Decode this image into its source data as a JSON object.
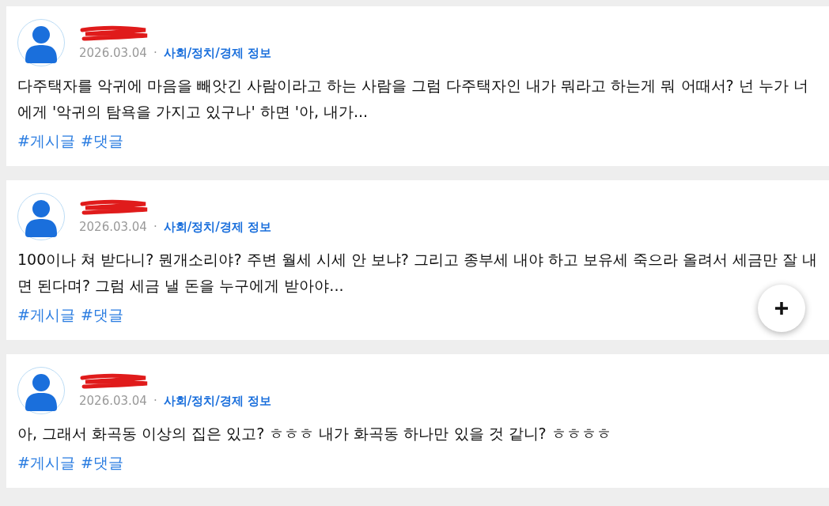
{
  "posts": [
    {
      "date": "2026.03.04",
      "separator": "·",
      "category": "사회/정치/경제 정보",
      "body": "다주택자를 악귀에 마음을 빼앗긴 사람이라고 하는 사람을 그럼 다주택자인 내가 뭐라고 하는게 뭐 어때서? 넌 누가 너에게 '악귀의 탐욕을 가지고 있구나' 하면 '아, 내가...",
      "tags": [
        "#게시글",
        "#댓글"
      ]
    },
    {
      "date": "2026.03.04",
      "separator": "·",
      "category": "사회/정치/경제 정보",
      "body": "100이나 쳐 받다니? 뭔개소리야? 주변 월세 시세 안 보냐? 그리고 종부세 내야 하고 보유세 죽으라 올려서 세금만 잘 내면 된다며? 그럼 세금 낼 돈을 누구에게 받아야...",
      "tags": [
        "#게시글",
        "#댓글"
      ]
    },
    {
      "date": "2026.03.04",
      "separator": "·",
      "category": "사회/정치/경제 정보",
      "body": "아, 그래서 화곡동 이상의 집은 있고? ㅎㅎㅎ 내가 화곡동 하나만 있을 것 같니? ㅎㅎㅎㅎ",
      "tags": [
        "#게시글",
        "#댓글"
      ]
    }
  ]
}
